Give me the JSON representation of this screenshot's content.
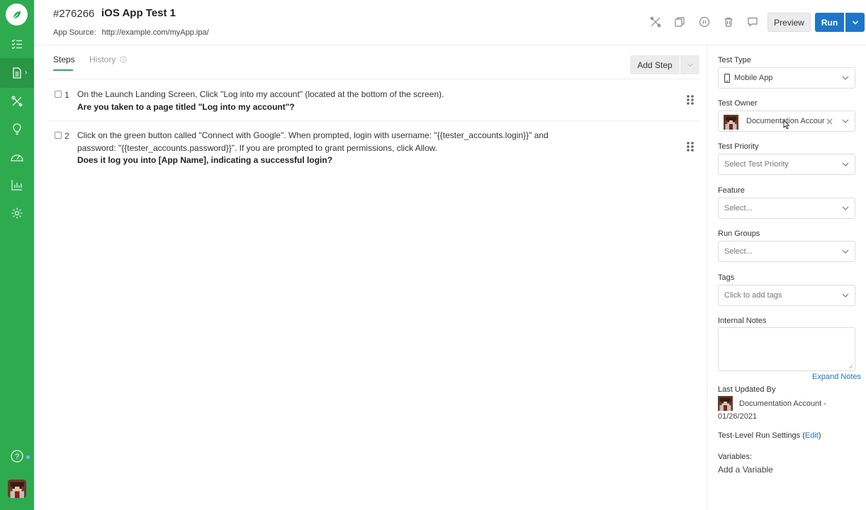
{
  "header": {
    "test_id": "#276266",
    "test_title": "iOS App Test 1",
    "app_source_label": "App Source:",
    "app_source_url": "http://example.com/myApp.ipa/",
    "preview_label": "Preview",
    "run_label": "Run"
  },
  "sidebar": {
    "items": [
      {
        "icon": "list-icon"
      },
      {
        "icon": "document-icon"
      },
      {
        "icon": "tools-icon"
      },
      {
        "icon": "lightbulb-icon"
      },
      {
        "icon": "speedometer-icon"
      },
      {
        "icon": "bar-chart-icon"
      },
      {
        "icon": "gear-icon"
      }
    ]
  },
  "tabs": {
    "steps": "Steps",
    "history": "History"
  },
  "add_step_label": "Add Step",
  "steps": [
    {
      "num": "1",
      "action": "On the Launch Landing Screen, Click \"Log into my account\" (located at the bottom of the screen).",
      "expected": "Are you taken to a page titled \"Log into my account\"?"
    },
    {
      "num": "2",
      "action": "Click on the green button called \"Connect with Google\". When prompted, login with username: \"{{tester_accounts.login}}\" and password: \"{{tester_accounts.password}}\". If you are prompted to grant permissions, click Allow.",
      "expected": "Does it log you into [App Name], indicating a successful login?"
    }
  ],
  "panel": {
    "test_type_label": "Test Type",
    "test_type_value": "Mobile App",
    "test_owner_label": "Test Owner",
    "test_owner_value": "Documentation Accour",
    "test_priority_label": "Test Priority",
    "test_priority_placeholder": "Select Test Priority",
    "feature_label": "Feature",
    "feature_placeholder": "Select...",
    "run_groups_label": "Run Groups",
    "run_groups_placeholder": "Select...",
    "tags_label": "Tags",
    "tags_placeholder": "Click to add tags",
    "internal_notes_label": "Internal Notes",
    "expand_notes": "Expand Notes",
    "last_updated_label": "Last Updated By",
    "last_updated_by": "Documentation Account -",
    "last_updated_date": "01/26/2021",
    "run_settings_label": "Test-Level Run Settings (",
    "run_settings_edit": "Edit",
    "run_settings_close": ")",
    "variables_label": "Variables:",
    "add_variable": "Add a Variable"
  },
  "colors": {
    "sidebar_green": "#2eab4f",
    "run_blue": "#1e76c9",
    "link_blue": "#1e76c9"
  }
}
